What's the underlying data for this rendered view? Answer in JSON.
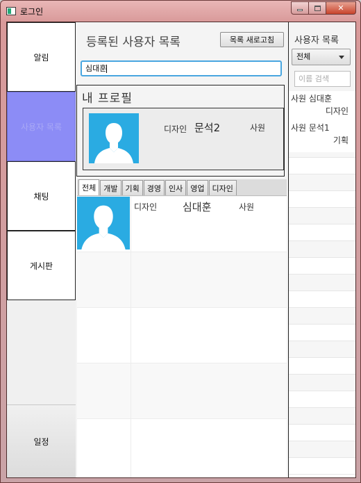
{
  "window": {
    "title": "로그인"
  },
  "sidebar": {
    "items": [
      {
        "label": "알림"
      },
      {
        "label": "사용자 목록"
      },
      {
        "label": "채팅"
      },
      {
        "label": "게시판"
      }
    ],
    "schedule_label": "일정"
  },
  "main": {
    "heading": "등록된 사용자 목록",
    "refresh_label": "목록 새로고침",
    "search_value": "심대훈",
    "profile": {
      "title": "내 프로필",
      "dept": "디자인",
      "name": "문석2",
      "rank": "사원",
      "avatar_icon": "user-silhouette-icon"
    },
    "tabs": [
      "전체",
      "개발",
      "기획",
      "경영",
      "인사",
      "영업",
      "디자인"
    ],
    "active_tab": "전체",
    "rows": [
      {
        "dept": "디자인",
        "name": "심대훈",
        "rank": "사원",
        "avatar_icon": "user-silhouette-icon"
      }
    ]
  },
  "right_panel": {
    "title": "사용자 목록",
    "filter_value": "전체",
    "search_placeholder": "이름 검색",
    "users": [
      {
        "line1": "사원 심대훈",
        "line2": "디자인"
      },
      {
        "line1": "사원 문석1",
        "line2": "기획"
      }
    ]
  },
  "colors": {
    "accent": "#8c8cf6",
    "avatar_bg": "#2aabe2",
    "search_focus": "#48a6e0"
  }
}
